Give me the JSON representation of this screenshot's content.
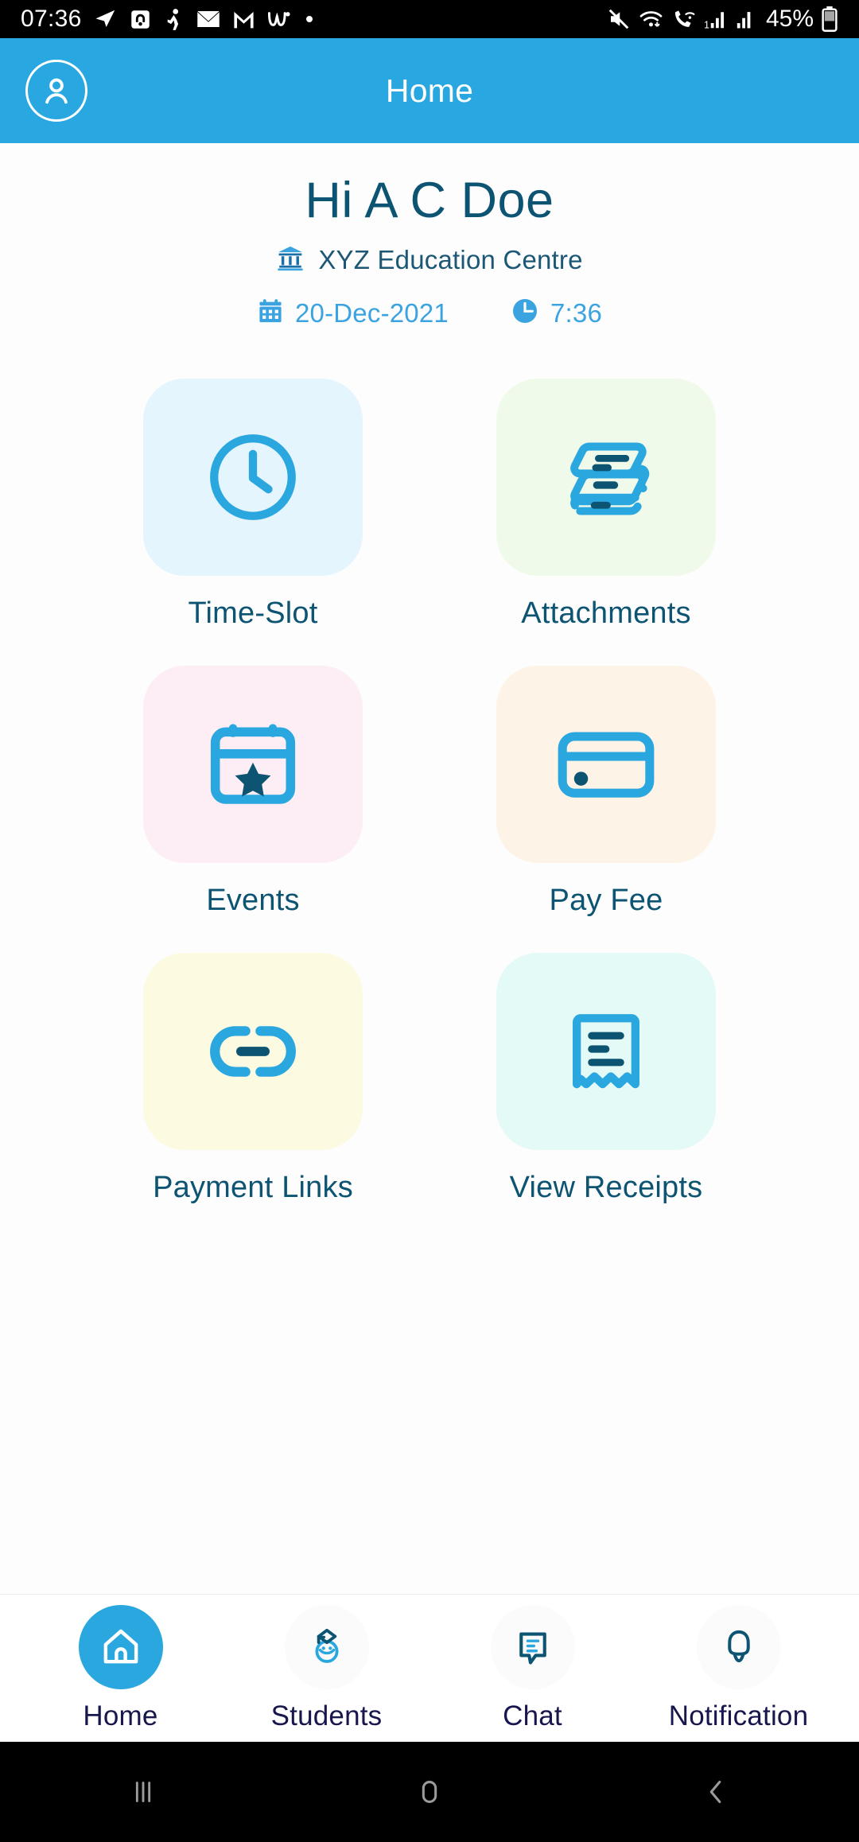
{
  "status_bar": {
    "time": "07:36",
    "battery_percent": "45%",
    "left_icons": [
      "telegram-icon",
      "headphone-app-icon",
      "running-app-icon",
      "mail-icon",
      "gmail-icon",
      "whatsapp-business-icon",
      "dot-icon"
    ],
    "right_icons": [
      "mute-icon",
      "wifi-icon",
      "call-wifi-icon",
      "signal-1-icon",
      "signal-2-icon",
      "battery-icon"
    ]
  },
  "app_bar": {
    "title": "Home",
    "avatar_icon": "user-avatar-icon",
    "background_color": "#29a7e1"
  },
  "greeting": {
    "name": "Hi A C Doe",
    "organisation": "XYZ Education Centre",
    "organisation_icon": "institution-icon",
    "date": "20-Dec-2021",
    "date_icon": "calendar-icon",
    "time": "7:36",
    "time_icon": "clock-icon",
    "name_color": "#0d5472",
    "date_color": "#3aa3e0"
  },
  "tiles": [
    {
      "label": "Time-Slot",
      "icon": "clock-icon",
      "bg": "#e4f5fd"
    },
    {
      "label": "Attachments",
      "icon": "documents-stack-icon",
      "bg": "#f0faea"
    },
    {
      "label": "Events",
      "icon": "calendar-star-icon",
      "bg": "#fdeef5"
    },
    {
      "label": "Pay Fee",
      "icon": "credit-card-icon",
      "bg": "#fdf3e6"
    },
    {
      "label": "Payment Links",
      "icon": "link-icon",
      "bg": "#fcfbe2"
    },
    {
      "label": "View Receipts",
      "icon": "receipt-icon",
      "bg": "#e4faf6"
    }
  ],
  "bottom_nav": [
    {
      "label": "Home",
      "icon": "home-icon",
      "active": true
    },
    {
      "label": "Students",
      "icon": "graduate-face-icon",
      "active": false
    },
    {
      "label": "Chat",
      "icon": "chat-bubble-icon",
      "active": false
    },
    {
      "label": "Notification",
      "icon": "bell-icon",
      "active": false
    }
  ],
  "android_nav": {
    "recents_icon": "recent-apps-icon",
    "home_icon": "android-home-icon",
    "back_icon": "android-back-icon"
  },
  "colors": {
    "primary_blue": "#29a7e1",
    "icon_blue": "#2ba7e0",
    "dark_teal": "#0d5472",
    "nav_label": "#17174e"
  }
}
